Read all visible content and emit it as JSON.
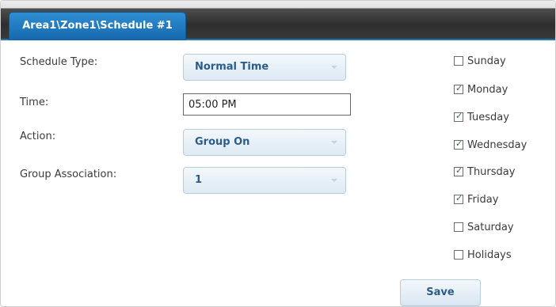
{
  "tab": {
    "title": "Area1\\Zone1\\Schedule #1"
  },
  "form": {
    "schedule_type": {
      "label": "Schedule Type:",
      "value": "Normal Time"
    },
    "time": {
      "label": "Time:",
      "value": "05:00 PM"
    },
    "action": {
      "label": "Action:",
      "value": "Group On"
    },
    "group_association": {
      "label": "Group Association:",
      "value": "1"
    }
  },
  "days": [
    {
      "label": "Sunday",
      "checked": false
    },
    {
      "label": "Monday",
      "checked": true
    },
    {
      "label": "Tuesday",
      "checked": true
    },
    {
      "label": "Wednesday",
      "checked": true
    },
    {
      "label": "Thursday",
      "checked": true
    },
    {
      "label": "Friday",
      "checked": true
    },
    {
      "label": "Saturday",
      "checked": false
    },
    {
      "label": "Holidays",
      "checked": false
    }
  ],
  "save_label": "Save",
  "colors": {
    "accent": "#1d78b4",
    "tab": "#2f8ed3",
    "control_text": "#2b5d8a"
  }
}
